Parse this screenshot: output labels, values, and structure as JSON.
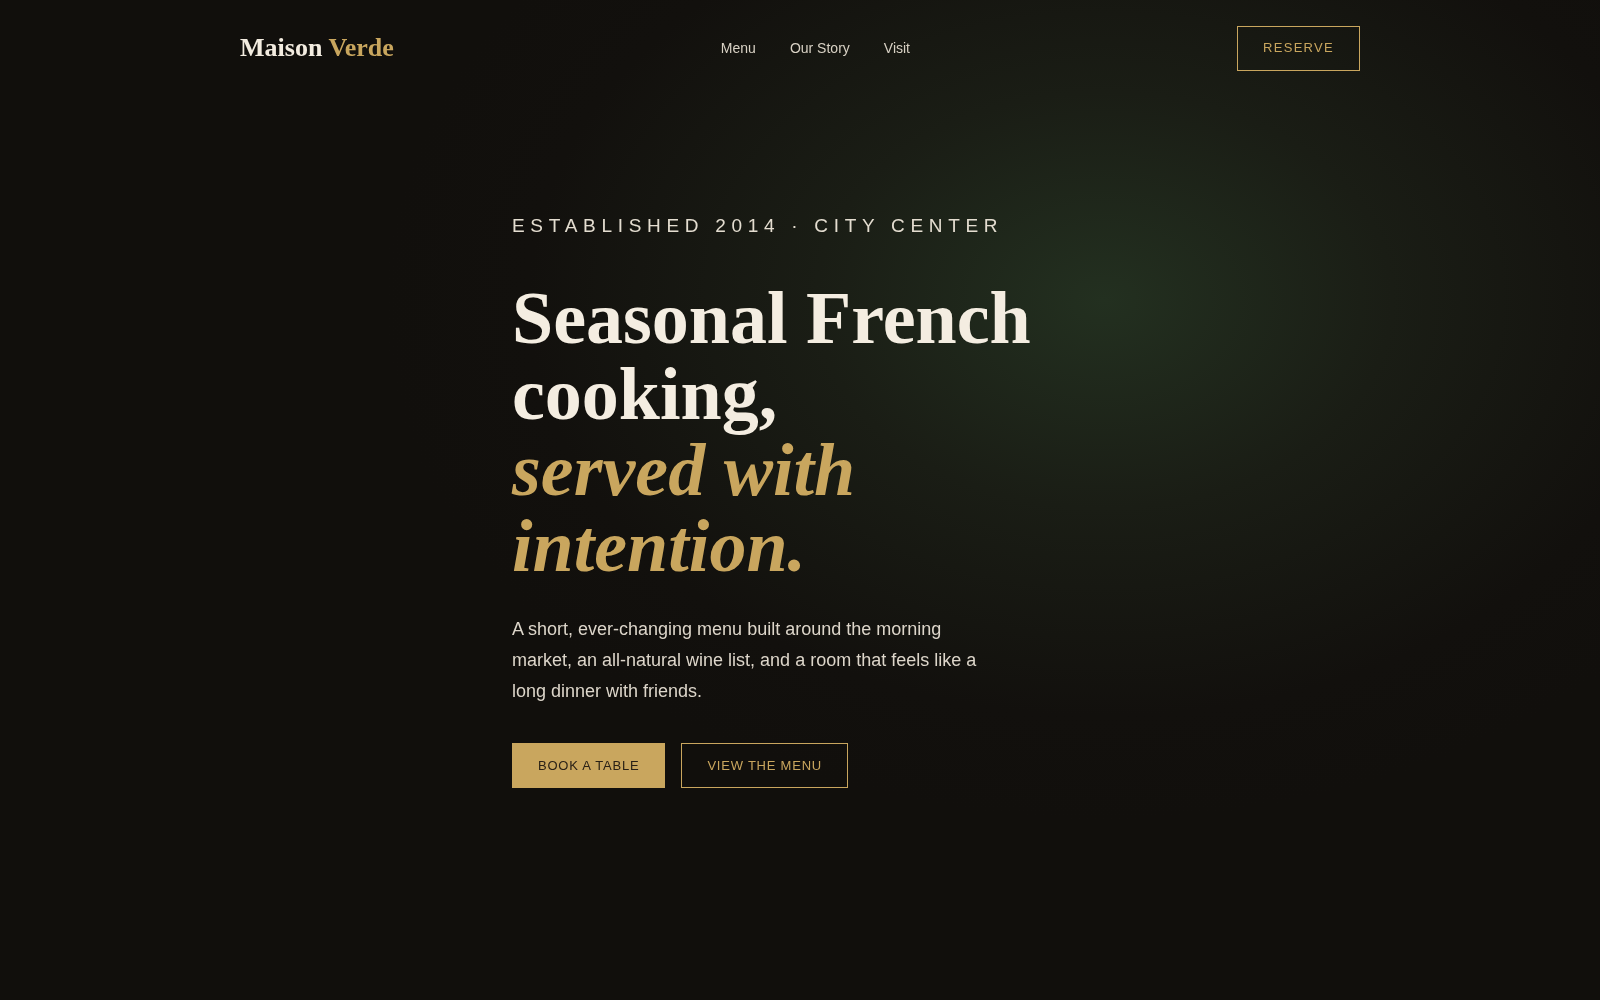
{
  "header": {
    "logo": {
      "name": "Maison",
      "accent": "Verde"
    },
    "nav": [
      {
        "label": "Menu"
      },
      {
        "label": "Our Story"
      },
      {
        "label": "Visit"
      }
    ],
    "reserve_button": "RESERVE"
  },
  "hero": {
    "eyebrow": "ESTABLISHED 2014 · CITY CENTER",
    "headline": "Seasonal French cooking, *served with intention.*",
    "description": "A short, ever-changing menu built around the morning market, an all-natural wine list, and a room that feels like a long dinner with friends.",
    "buttons": [
      {
        "label": "BOOK A TABLE",
        "kind": "primary"
      },
      {
        "label": "VIEW THE MENU",
        "kind": "outline"
      }
    ]
  }
}
